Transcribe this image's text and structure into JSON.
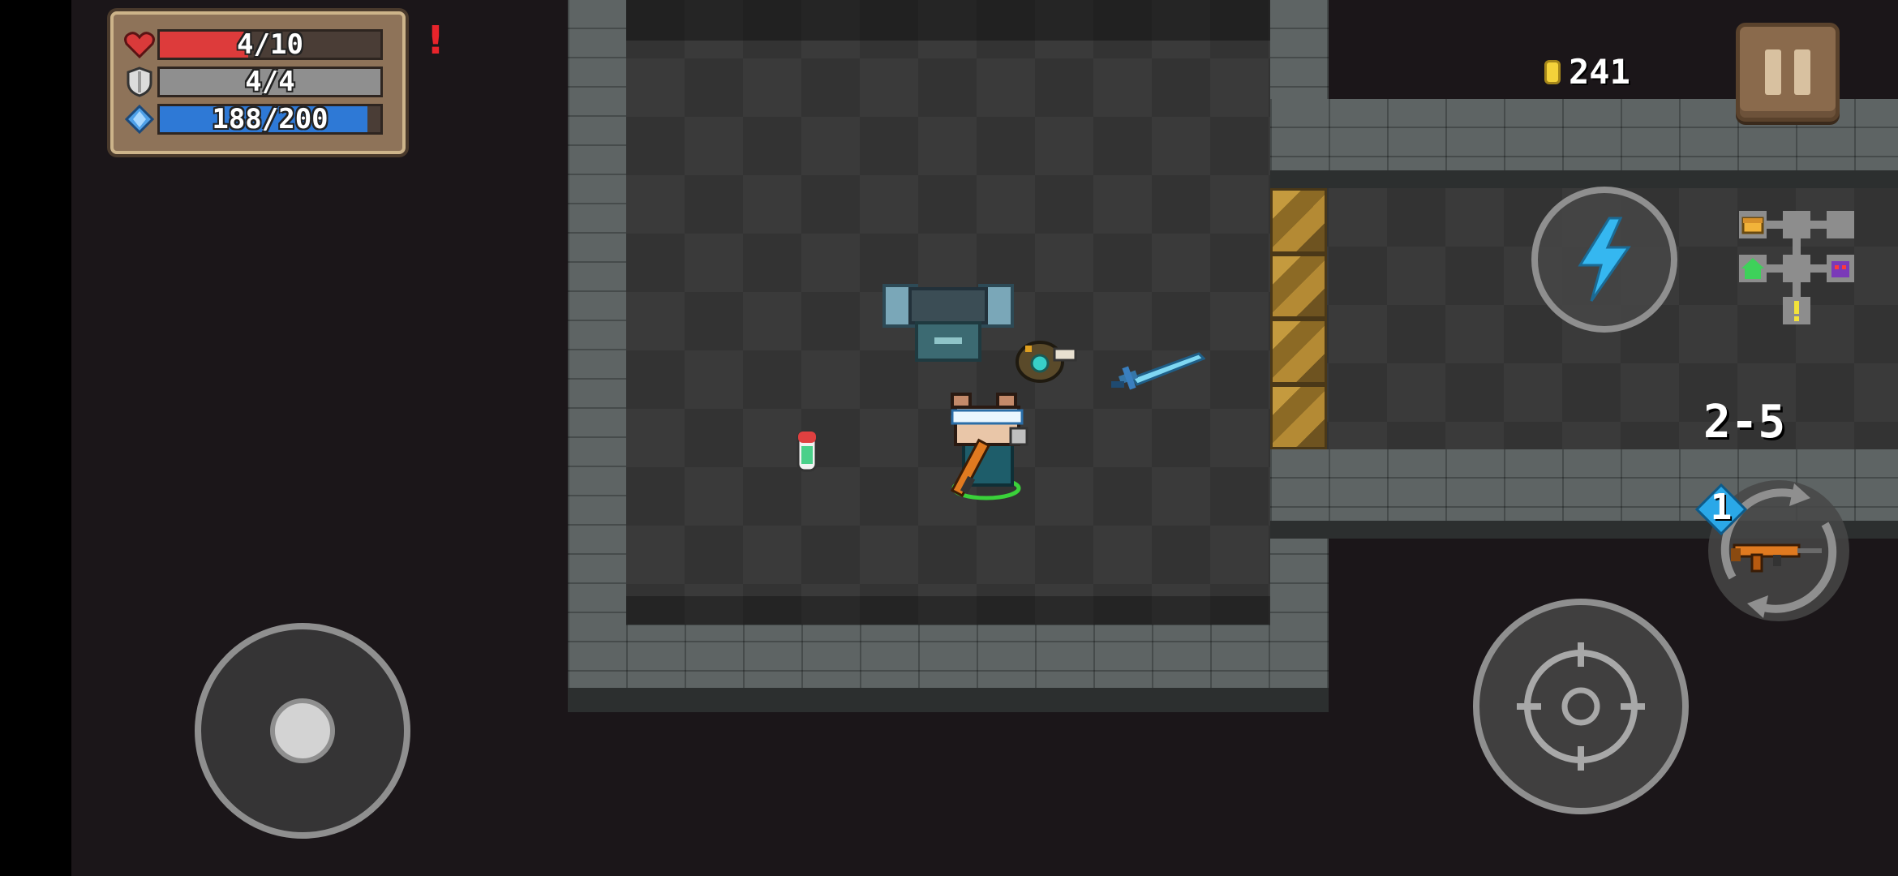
{
  "hud": {
    "health": {
      "label": "4/10",
      "current": 4,
      "max": 10,
      "color": "#dd3b3b"
    },
    "armor": {
      "label": "4/4",
      "current": 4,
      "max": 4,
      "color": "#8f8f8f"
    },
    "energy": {
      "label": "188/200",
      "current": 188,
      "max": 200,
      "color": "#2e79d6"
    },
    "alert_text": "!",
    "coins": "241",
    "level": "2-5",
    "weapon_slot_badge": "1"
  },
  "icons": {
    "health": "heart-icon",
    "armor": "shield-icon",
    "energy": "diamond-icon",
    "coin": "coin-icon",
    "pause": "pause-icon",
    "skill": "lightning-icon",
    "attack": "crosshair-icon",
    "weapon": "rifle-icon",
    "swap": "swap-arrows-icon"
  },
  "colors": {
    "health_fill": "#dd3b3b",
    "armor_fill": "#8f8f8f",
    "energy_fill": "#2e79d6",
    "skill_bolt": "#35b7f0",
    "alert": "#e8242b",
    "coin": "#f4d23a",
    "panel": "#8e7359"
  }
}
